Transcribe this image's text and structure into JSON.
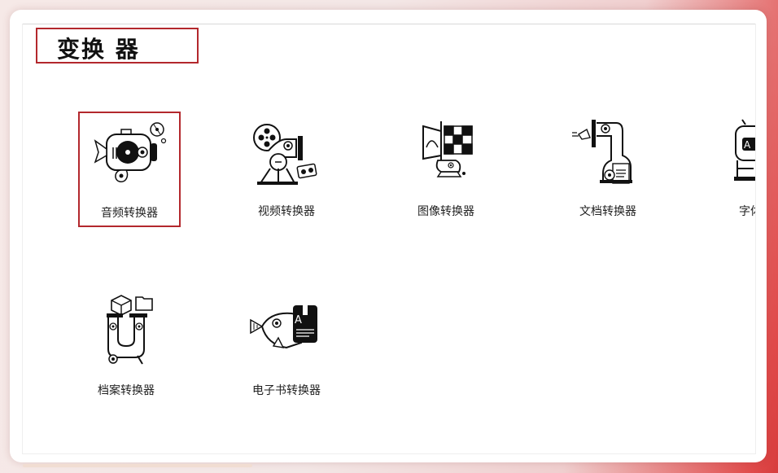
{
  "page": {
    "title": "变换 器"
  },
  "converters": [
    {
      "label": "音频转换器",
      "icon": "audio-converter-icon",
      "selected": true
    },
    {
      "label": "视频转换器",
      "icon": "video-converter-icon"
    },
    {
      "label": "图像转换器",
      "icon": "image-converter-icon"
    },
    {
      "label": "文档转换器",
      "icon": "document-converter-icon"
    },
    {
      "label": "字体转换器",
      "icon": "font-converter-icon"
    },
    {
      "label": "档案转换器",
      "icon": "archive-converter-icon"
    },
    {
      "label": "电子书转换器",
      "icon": "ebook-converter-icon"
    }
  ],
  "colors": {
    "accent_border": "#b3282d",
    "ink": "#111111"
  }
}
